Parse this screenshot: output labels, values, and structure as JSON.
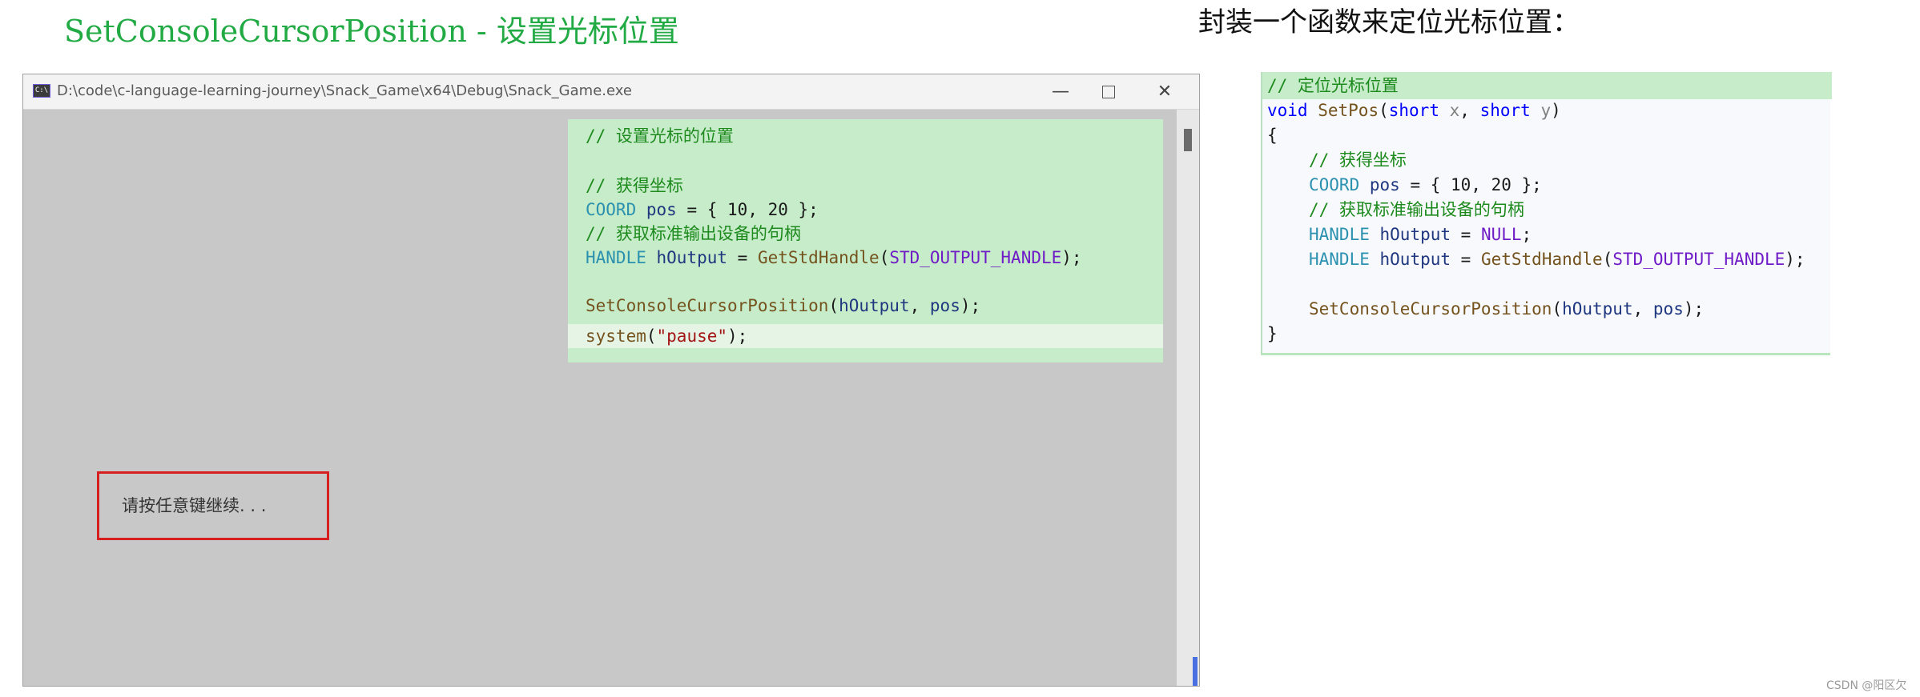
{
  "heading_left": "SetConsoleCursorPosition - 设置光标位置",
  "heading_right": "封装一个函数来定位光标位置：",
  "console": {
    "title": "D:\\code\\c-language-learning-journey\\Snack_Game\\x64\\Debug\\Snack_Game.exe",
    "icon_text": "C:\\",
    "minimize_glyph": "—",
    "close_glyph": "✕",
    "prompt": "请按任意键继续. . ."
  },
  "code_panel": {
    "l1": "// 设置光标的位置",
    "l2": "// 获得坐标",
    "l3_type": "COORD",
    "l3_var": "pos",
    "l3_rest": " = { 10, 20 };",
    "l4": "// 获取标准输出设备的句柄",
    "l5_type": "HANDLE",
    "l5_var": "hOutput",
    "l5_eq": " = ",
    "l5_func": "GetStdHandle",
    "l5_open": "(",
    "l5_macro": "STD_OUTPUT_HANDLE",
    "l5_close": ");",
    "l6_func": "SetConsoleCursorPosition",
    "l6_open": "(",
    "l6_arg1": "hOutput",
    "l6_comma": ", ",
    "l6_arg2": "pos",
    "l6_close": ");",
    "l7_func": "system",
    "l7_open": "(",
    "l7_str": "\"pause\"",
    "l7_close": ");"
  },
  "code_func": {
    "l1": "// 定位光标位置",
    "l2_kw": "void",
    "l2_name": "SetPos",
    "l2_open": "(",
    "l2_t1": "short",
    "l2_p1": "x",
    "l2_sep": ", ",
    "l2_t2": "short",
    "l2_p2": "y",
    "l2_close": ")",
    "l3": "{",
    "l4": "// 获得坐标",
    "l5_type": "COORD",
    "l5_var": "pos",
    "l5_rest": " = { 10, 20 };",
    "l6": "// 获取标准输出设备的句柄",
    "l7_type": "HANDLE",
    "l7_var": "hOutput",
    "l7_eq": " = ",
    "l7_macro": "NULL",
    "l7_end": ";",
    "l8_type": "HANDLE",
    "l8_var": "hOutput",
    "l8_eq": " = ",
    "l8_func": "GetStdHandle",
    "l8_open": "(",
    "l8_macro": "STD_OUTPUT_HANDLE",
    "l8_close": ");",
    "l9_func": "SetConsoleCursorPosition",
    "l9_open": "(",
    "l9_arg1": "hOutput",
    "l9_comma": ", ",
    "l9_arg2": "pos",
    "l9_close": ");",
    "l10": "}"
  },
  "watermark": "CSDN @阳区欠"
}
